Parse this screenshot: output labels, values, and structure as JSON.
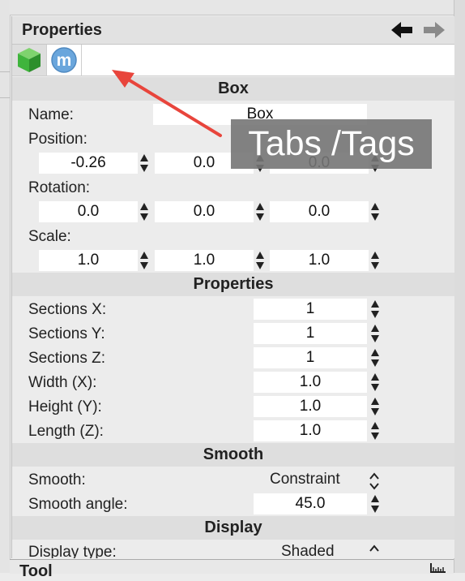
{
  "panel": {
    "title": "Properties",
    "nav": {
      "back_icon": "arrow-left-icon",
      "forward_icon": "arrow-right-icon"
    },
    "tabs": [
      {
        "icon": "green-cube-icon",
        "active": true
      },
      {
        "icon": "m-circle-icon",
        "letter": "m",
        "active": false
      }
    ]
  },
  "box": {
    "header": "Box",
    "name_label": "Name:",
    "name_value": "Box",
    "position_label": "Position:",
    "position": [
      "-0.26",
      "0.0",
      "0.0"
    ],
    "rotation_label": "Rotation:",
    "rotation": [
      "0.0",
      "0.0",
      "0.0"
    ],
    "scale_label": "Scale:",
    "scale": [
      "1.0",
      "1.0",
      "1.0"
    ]
  },
  "properties": {
    "header": "Properties",
    "rows": [
      {
        "label": "Sections X:",
        "value": "1"
      },
      {
        "label": "Sections Y:",
        "value": "1"
      },
      {
        "label": "Sections Z:",
        "value": "1"
      },
      {
        "label": "Width (X):",
        "value": "1.0"
      },
      {
        "label": "Height (Y):",
        "value": "1.0"
      },
      {
        "label": "Length (Z):",
        "value": "1.0"
      }
    ]
  },
  "smooth": {
    "header": "Smooth",
    "smooth_label": "Smooth:",
    "smooth_value": "Constraint",
    "angle_label": "Smooth angle:",
    "angle_value": "45.0"
  },
  "display": {
    "header": "Display",
    "type_label": "Display type:",
    "type_value": "Shaded"
  },
  "bottom_panel": {
    "title": "Tool"
  },
  "annotation": {
    "text": "Tabs /Tags"
  },
  "colors": {
    "accent_arrow": "#e8453c",
    "cube_green": "#3fb43c",
    "m_blue": "#6aa6dc"
  }
}
